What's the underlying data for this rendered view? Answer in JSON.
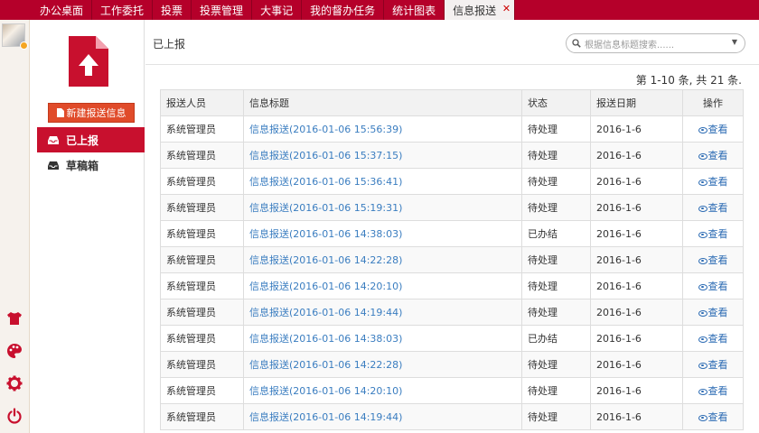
{
  "topnav": {
    "tabs": [
      "办公桌面",
      "工作委托",
      "投票",
      "投票管理",
      "大事记",
      "我的督办任务",
      "统计图表",
      "信息报送"
    ],
    "active_tab": "信息报送",
    "close_glyph": "✕"
  },
  "sidebar": {
    "new_button": "新建报送信息",
    "items": [
      {
        "label": "已上报"
      },
      {
        "label": "草稿箱"
      }
    ]
  },
  "main": {
    "breadcrumb": "已上报",
    "search_placeholder": "根据信息标题搜索......",
    "pagination": "第 1-10 条, 共 21 条."
  },
  "table": {
    "headers": [
      "报送人员",
      "信息标题",
      "状态",
      "报送日期",
      "操作"
    ],
    "view_label": "查看",
    "rows": [
      {
        "sender": "系统管理员",
        "title": "信息报送(2016-01-06 15:56:39)",
        "status": "待处理",
        "date": "2016-1-6"
      },
      {
        "sender": "系统管理员",
        "title": "信息报送(2016-01-06 15:37:15)",
        "status": "待处理",
        "date": "2016-1-6"
      },
      {
        "sender": "系统管理员",
        "title": "信息报送(2016-01-06 15:36:41)",
        "status": "待处理",
        "date": "2016-1-6"
      },
      {
        "sender": "系统管理员",
        "title": "信息报送(2016-01-06 15:19:31)",
        "status": "待处理",
        "date": "2016-1-6"
      },
      {
        "sender": "系统管理员",
        "title": "信息报送(2016-01-06 14:38:03)",
        "status": "已办结",
        "date": "2016-1-6"
      },
      {
        "sender": "系统管理员",
        "title": "信息报送(2016-01-06 14:22:28)",
        "status": "待处理",
        "date": "2016-1-6"
      },
      {
        "sender": "系统管理员",
        "title": "信息报送(2016-01-06 14:20:10)",
        "status": "待处理",
        "date": "2016-1-6"
      },
      {
        "sender": "系统管理员",
        "title": "信息报送(2016-01-06 14:19:44)",
        "status": "待处理",
        "date": "2016-1-6"
      },
      {
        "sender": "系统管理员",
        "title": "信息报送(2016-01-06 14:38:03)",
        "status": "已办结",
        "date": "2016-1-6"
      },
      {
        "sender": "系统管理员",
        "title": "信息报送(2016-01-06 14:22:28)",
        "status": "待处理",
        "date": "2016-1-6"
      },
      {
        "sender": "系统管理员",
        "title": "信息报送(2016-01-06 14:20:10)",
        "status": "待处理",
        "date": "2016-1-6"
      },
      {
        "sender": "系统管理员",
        "title": "信息报送(2016-01-06 14:19:44)",
        "status": "待处理",
        "date": "2016-1-6"
      }
    ]
  },
  "leftbar": {
    "icons": [
      "shirt-icon",
      "palette-icon",
      "gear-icon",
      "power-icon"
    ]
  },
  "colors": {
    "brand": "#b5002a",
    "accent": "#c8102e",
    "button": "#e04b2a",
    "link": "#3a7dc0"
  }
}
